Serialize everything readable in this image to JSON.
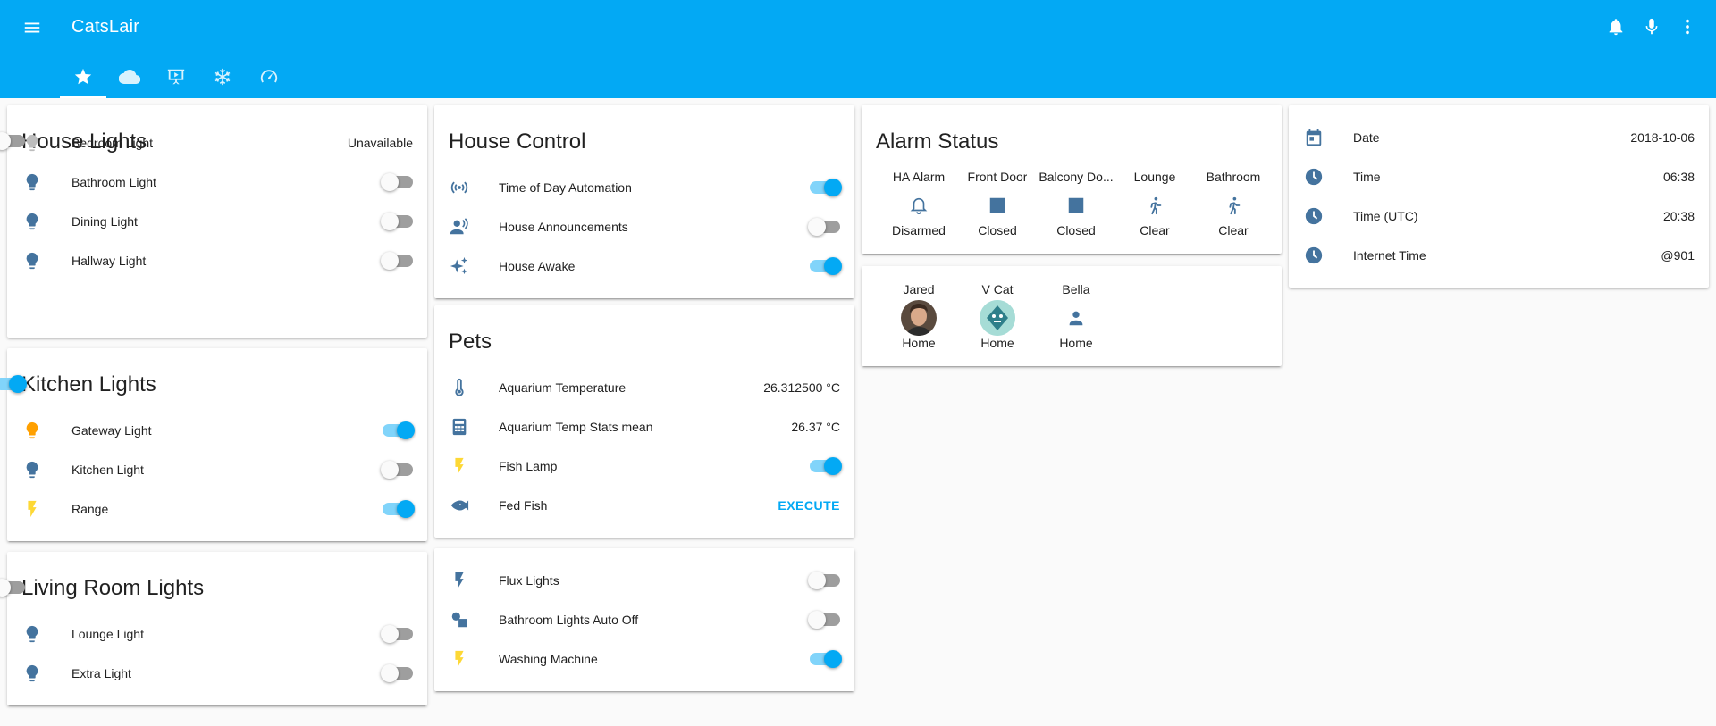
{
  "app": {
    "title": "CatsLair"
  },
  "colors": {
    "header": "#03a9f4",
    "icon": "#44739e",
    "icon_active": "#fdd835",
    "icon_light_on": "#ffa000",
    "icon_unavailable": "#bdbdbd",
    "toggle_on": "#03a9f4"
  },
  "header": {
    "icons": [
      "menu-icon",
      "bell-icon",
      "microphone-icon",
      "more-vertical-icon"
    ],
    "tabs": [
      {
        "icon": "star-icon",
        "active": true
      },
      {
        "icon": "cloud-icon",
        "active": false
      },
      {
        "icon": "presentation-play-icon",
        "active": false
      },
      {
        "icon": "snowflake-icon",
        "active": false
      },
      {
        "icon": "speedometer-icon",
        "active": false
      }
    ]
  },
  "house_lights": {
    "title": "House Lights",
    "toggle_on": false,
    "rows": [
      {
        "name": "Bedroom Light",
        "state": "Unavailable",
        "icon": "lightbulb-icon"
      },
      {
        "name": "Bathroom Light",
        "on": false,
        "icon": "lightbulb-icon"
      },
      {
        "name": "Dining Light",
        "on": false,
        "icon": "lightbulb-icon"
      },
      {
        "name": "Hallway Light",
        "on": false,
        "icon": "lightbulb-icon"
      }
    ]
  },
  "kitchen_lights": {
    "title": "Kitchen Lights",
    "toggle_on": true,
    "rows": [
      {
        "name": "Gateway Light",
        "on": true,
        "icon": "lightbulb-icon"
      },
      {
        "name": "Kitchen Light",
        "on": false,
        "icon": "lightbulb-icon"
      },
      {
        "name": "Range",
        "on": true,
        "icon": "flash-icon"
      }
    ]
  },
  "living_room_lights": {
    "title": "Living Room Lights",
    "toggle_on": false,
    "rows": [
      {
        "name": "Lounge Light",
        "on": false,
        "icon": "lightbulb-icon"
      },
      {
        "name": "Extra Light",
        "on": false,
        "icon": "lightbulb-icon"
      }
    ]
  },
  "house_control": {
    "title": "House Control",
    "rows": [
      {
        "name": "Time of Day Automation",
        "on": true,
        "icon": "broadcast-icon"
      },
      {
        "name": "House Announcements",
        "on": false,
        "icon": "account-voice-icon"
      },
      {
        "name": "House Awake",
        "on": true,
        "icon": "sparkle-icon"
      }
    ]
  },
  "pets": {
    "title": "Pets",
    "rows": [
      {
        "name": "Aquarium Temperature",
        "state": "26.312500 °C",
        "icon": "thermometer-icon"
      },
      {
        "name": "Aquarium Temp Stats mean",
        "state": "26.37 °C",
        "icon": "calculator-icon"
      },
      {
        "name": "Fish Lamp",
        "on": true,
        "icon": "flash-icon"
      },
      {
        "name": "Fed Fish",
        "action": "EXECUTE",
        "icon": "fish-icon"
      }
    ]
  },
  "switches": {
    "rows": [
      {
        "name": "Flux Lights",
        "on": false,
        "icon": "flash-icon"
      },
      {
        "name": "Bathroom Lights Auto Off",
        "on": false,
        "icon": "shapes-icon"
      },
      {
        "name": "Washing Machine",
        "on": true,
        "icon": "flash-icon"
      }
    ]
  },
  "alarm_status": {
    "title": "Alarm Status",
    "badges": [
      {
        "name": "HA Alarm",
        "state": "Disarmed",
        "icon": "bell-outline-icon"
      },
      {
        "name": "Front Door",
        "state": "Closed",
        "icon": "square-icon"
      },
      {
        "name": "Balcony Do...",
        "state": "Closed",
        "icon": "square-icon"
      },
      {
        "name": "Lounge",
        "state": "Clear",
        "icon": "walk-icon"
      },
      {
        "name": "Bathroom",
        "state": "Clear",
        "icon": "walk-icon"
      }
    ]
  },
  "people": {
    "badges": [
      {
        "name": "Jared",
        "state": "Home",
        "icon": "avatar-photo"
      },
      {
        "name": "V Cat",
        "state": "Home",
        "icon": "avatar-robot"
      },
      {
        "name": "Bella",
        "state": "Home",
        "icon": "account-icon"
      }
    ]
  },
  "date_time": {
    "rows": [
      {
        "name": "Date",
        "state": "2018-10-06",
        "icon": "calendar-icon"
      },
      {
        "name": "Time",
        "state": "06:38",
        "icon": "clock-icon"
      },
      {
        "name": "Time (UTC)",
        "state": "20:38",
        "icon": "clock-icon"
      },
      {
        "name": "Internet Time",
        "state": "@901",
        "icon": "clock-icon"
      }
    ]
  }
}
